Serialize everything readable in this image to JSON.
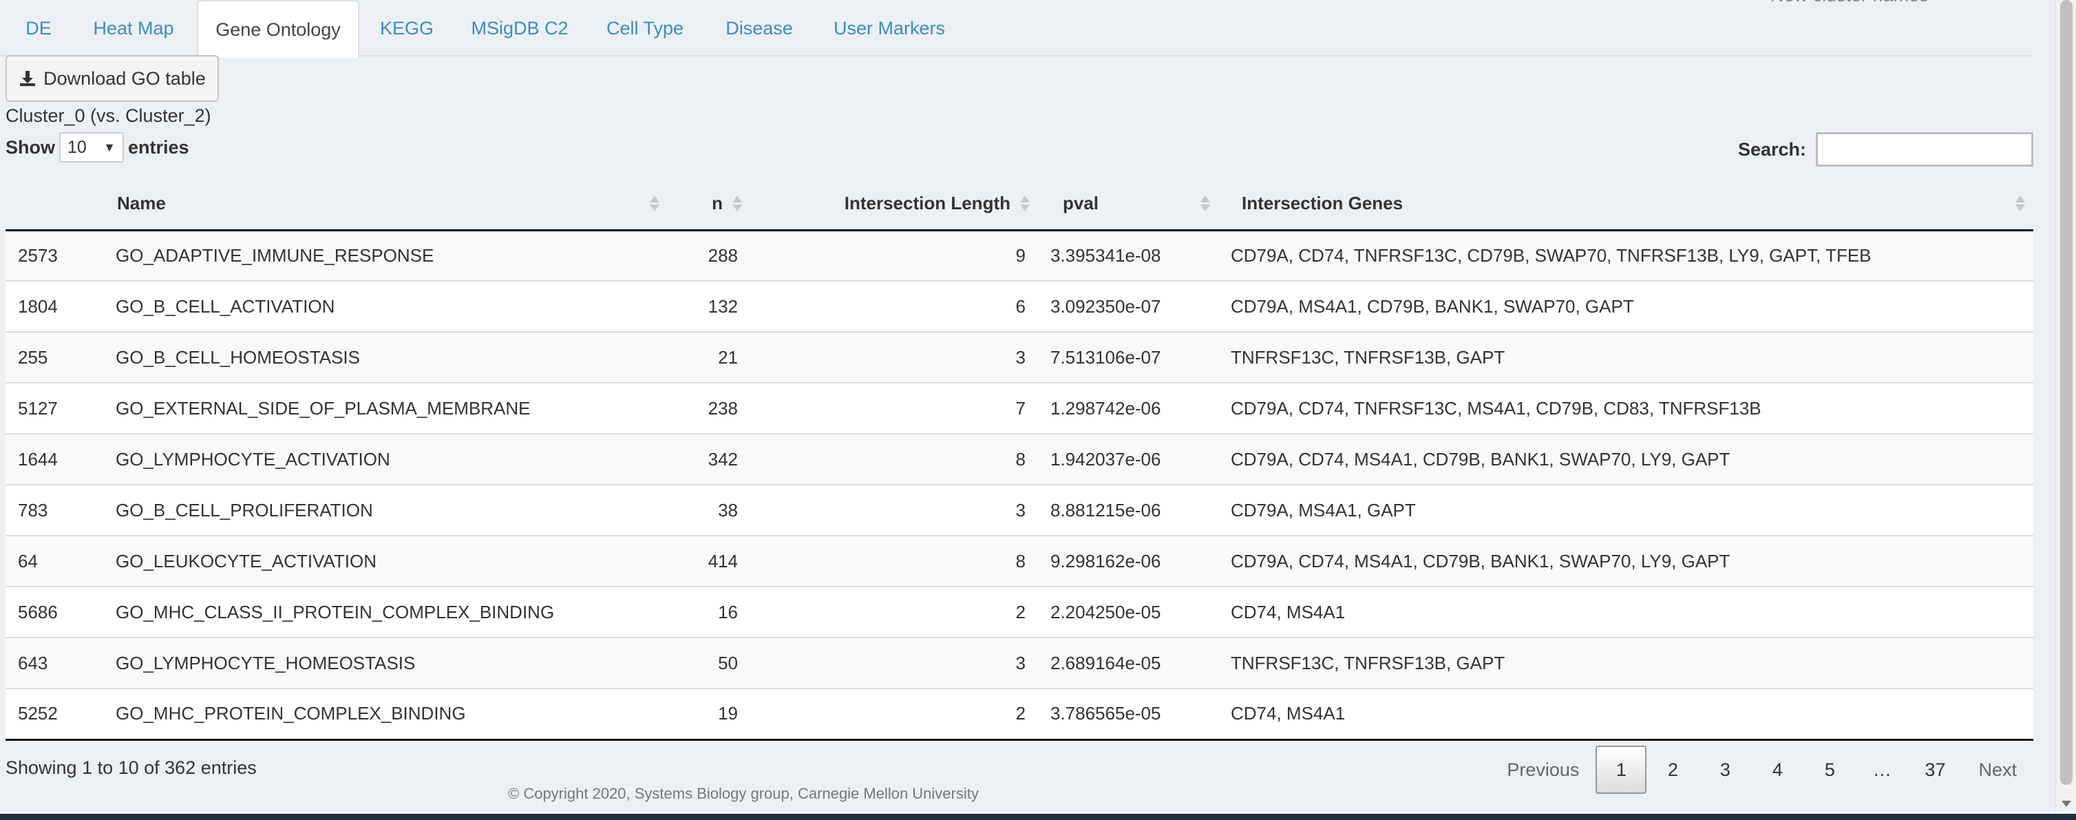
{
  "tabs": [
    {
      "label": "DE",
      "active": false
    },
    {
      "label": "Heat Map",
      "active": false
    },
    {
      "label": "Gene Ontology",
      "active": true
    },
    {
      "label": "KEGG",
      "active": false
    },
    {
      "label": "MSigDB C2",
      "active": false
    },
    {
      "label": "Cell Type",
      "active": false
    },
    {
      "label": "Disease",
      "active": false
    },
    {
      "label": "User Markers",
      "active": false
    }
  ],
  "clipped_text": "New cluster names",
  "download_button": {
    "label": "Download GO table",
    "icon": "download-icon"
  },
  "cluster_label": "Cluster_0 (vs. Cluster_2)",
  "length_control": {
    "prefix": "Show",
    "value": "10",
    "suffix": "entries"
  },
  "search": {
    "label": "Search:",
    "value": ""
  },
  "table": {
    "columns": [
      "",
      "Name",
      "n",
      "Intersection Length",
      "pval",
      "Intersection Genes"
    ],
    "rows": [
      [
        "2573",
        "GO_ADAPTIVE_IMMUNE_RESPONSE",
        "288",
        "9",
        "3.395341e-08",
        "CD79A, CD74, TNFRSF13C, CD79B, SWAP70, TNFRSF13B, LY9, GAPT, TFEB"
      ],
      [
        "1804",
        "GO_B_CELL_ACTIVATION",
        "132",
        "6",
        "3.092350e-07",
        "CD79A, MS4A1, CD79B, BANK1, SWAP70, GAPT"
      ],
      [
        "255",
        "GO_B_CELL_HOMEOSTASIS",
        "21",
        "3",
        "7.513106e-07",
        "TNFRSF13C, TNFRSF13B, GAPT"
      ],
      [
        "5127",
        "GO_EXTERNAL_SIDE_OF_PLASMA_MEMBRANE",
        "238",
        "7",
        "1.298742e-06",
        "CD79A, CD74, TNFRSF13C, MS4A1, CD79B, CD83, TNFRSF13B"
      ],
      [
        "1644",
        "GO_LYMPHOCYTE_ACTIVATION",
        "342",
        "8",
        "1.942037e-06",
        "CD79A, CD74, MS4A1, CD79B, BANK1, SWAP70, LY9, GAPT"
      ],
      [
        "783",
        "GO_B_CELL_PROLIFERATION",
        "38",
        "3",
        "8.881215e-06",
        "CD79A, MS4A1, GAPT"
      ],
      [
        "64",
        "GO_LEUKOCYTE_ACTIVATION",
        "414",
        "8",
        "9.298162e-06",
        "CD79A, CD74, MS4A1, CD79B, BANK1, SWAP70, LY9, GAPT"
      ],
      [
        "5686",
        "GO_MHC_CLASS_II_PROTEIN_COMPLEX_BINDING",
        "16",
        "2",
        "2.204250e-05",
        "CD74, MS4A1"
      ],
      [
        "643",
        "GO_LYMPHOCYTE_HOMEOSTASIS",
        "50",
        "3",
        "2.689164e-05",
        "TNFRSF13C, TNFRSF13B, GAPT"
      ],
      [
        "5252",
        "GO_MHC_PROTEIN_COMPLEX_BINDING",
        "19",
        "2",
        "3.786565e-05",
        "CD74, MS4A1"
      ]
    ]
  },
  "info": "Showing 1 to 10 of 362 entries",
  "pagination": {
    "previous": "Previous",
    "pages": [
      "1",
      "2",
      "3",
      "4",
      "5",
      "…",
      "37"
    ],
    "current": "1",
    "next": "Next"
  },
  "footer": "© Copyright 2020, Systems Biology group, Carnegie Mellon University",
  "colors": {
    "background": "#ecf0f5",
    "link": "#3c8dbc",
    "text": "#333333",
    "bottom_bar": "#1f2d3d"
  }
}
